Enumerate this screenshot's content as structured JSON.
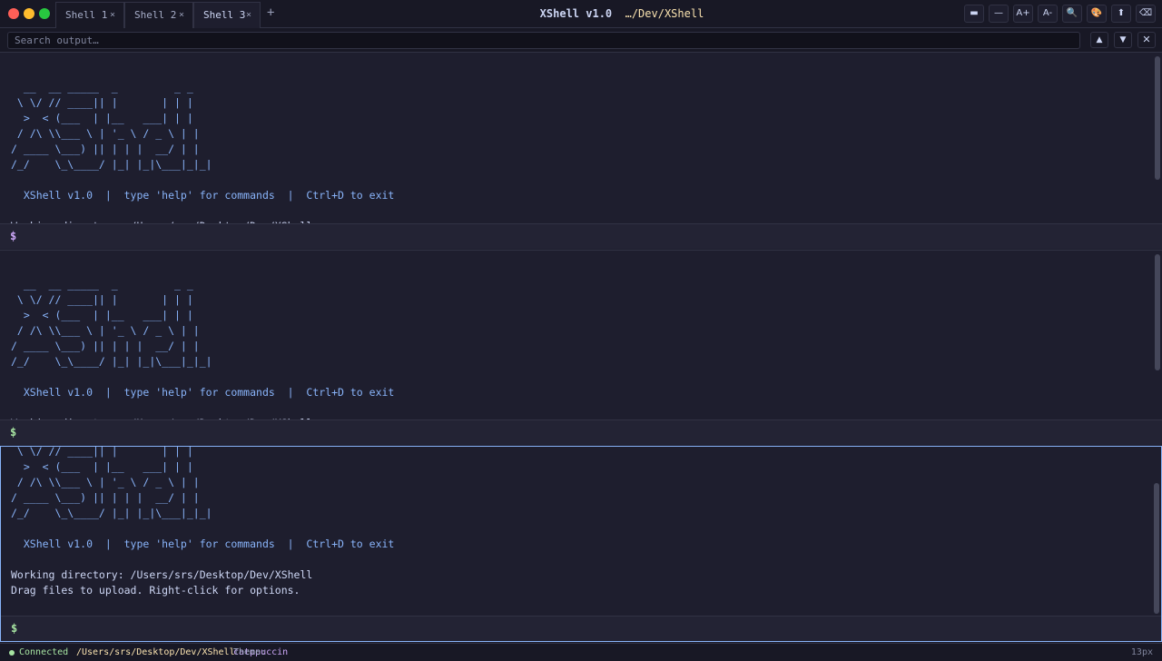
{
  "window": {
    "app": "XShell v1.0",
    "path": "…/Dev/XShell"
  },
  "tabs": [
    {
      "label": "Shell 1",
      "close": "×",
      "active": false
    },
    {
      "label": "Shell 2",
      "close": "×",
      "active": false
    },
    {
      "label": "Shell 3",
      "close": "×",
      "active": true
    }
  ],
  "new_tab": "+",
  "toolbar": {
    "buttons": [
      {
        "name": "split-vertical",
        "label": "▬"
      },
      {
        "name": "split-horizontal",
        "label": "—"
      },
      {
        "name": "font-increase",
        "label": "A+"
      },
      {
        "name": "font-decrease",
        "label": "A-"
      },
      {
        "name": "search",
        "label": "🔍"
      },
      {
        "name": "theme",
        "label": "🎨"
      },
      {
        "name": "upload",
        "label": "⬆"
      },
      {
        "name": "clear",
        "label": "⌫"
      }
    ]
  },
  "search": {
    "placeholder": "Search output…",
    "prev": "▲",
    "next": "▼",
    "close": "✕"
  },
  "terminal": {
    "banner": "  __  __ _____  _         _ _\n \\ \\/ // ____|| |       | | |\n  >  < (___  | |__   ___| | |\n / /\\ \\\\___ \\ | '_ \\ / _ \\ | |\n/ ____ \\___) || | | |  __/ | |\n/_/    \\_\\____/ |_| |_|\\___|_|_|",
    "banner_tail": " \\ \\/ // ____|| |       | | |\n  >  < (___  | |__   ___| | |\n / /\\ \\\\___ \\ | '_ \\ / _ \\ | |\n/ ____ \\___) || | | |  __/ | |\n/_/    \\_\\____/ |_| |_|\\___|_|_|",
    "info_line": "  XShell v1.0  |  type 'help' for commands  |  Ctrl+D to exit",
    "working_dir": "Working directory: /Users/srs/Desktop/Dev/XShell",
    "drag_hint": "Drag files to upload. Right-click for options.",
    "prompt": "$"
  },
  "colors": {
    "background": "#1e1e2e",
    "ascii": "#89b4fa",
    "prompt_pane1": "#cba6f7",
    "prompt_pane2": "#a6e3a1",
    "prompt_pane3": "#a6e3a1",
    "active_border": "#89b4fa"
  },
  "status": {
    "connected": "Connected",
    "path": "/Users/srs/Desktop/Dev/XShell",
    "theme_label": "Theme:",
    "theme_value": "catppuccin",
    "font_size": "13px"
  }
}
